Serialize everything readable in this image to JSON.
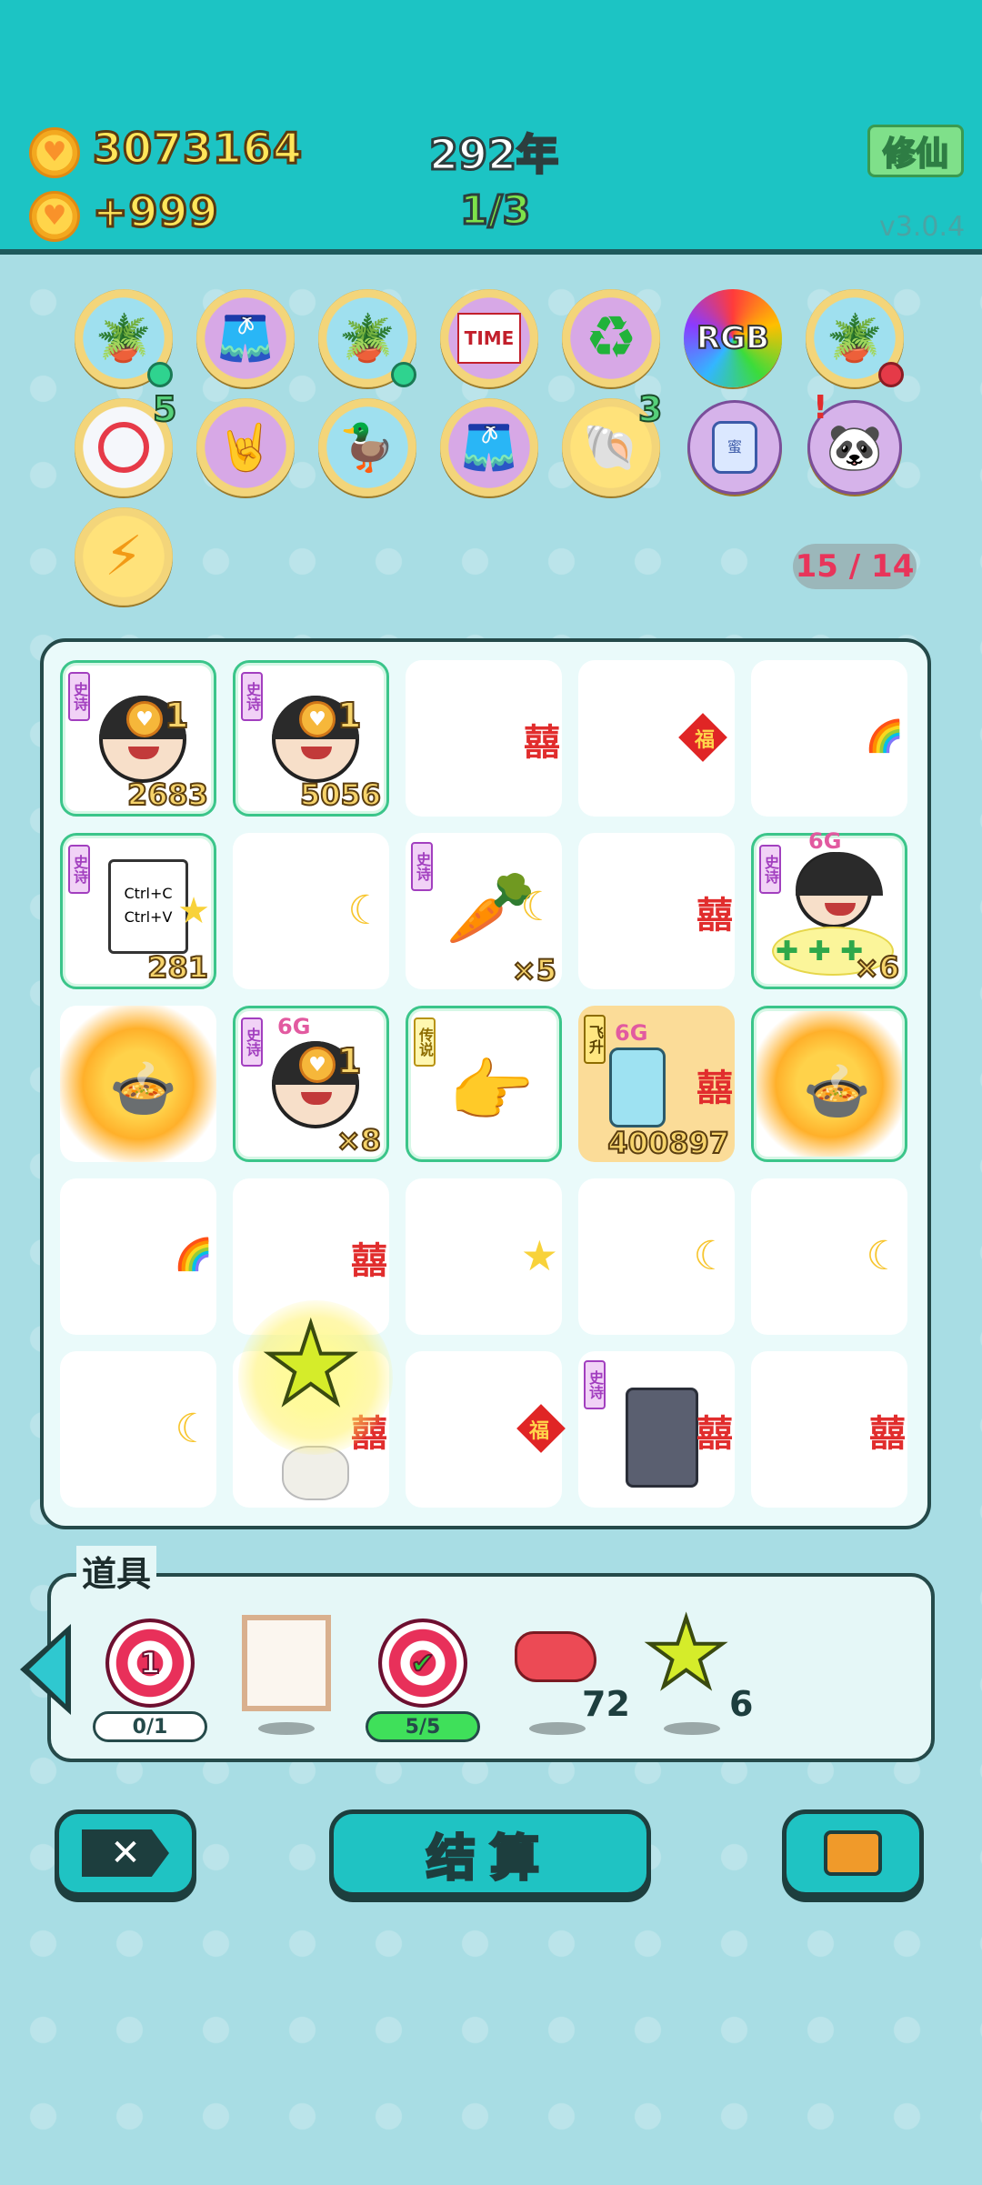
{
  "header": {
    "coins": "3073164",
    "income": "+999",
    "year": "292年",
    "round": "1/3",
    "mode_button": "修仙",
    "version": "v3.0.4"
  },
  "badges_row1": [
    "flower-pot-icon",
    "skirt-icon",
    "flower-pot-icon",
    "time-magazine-icon",
    "recycle-icon",
    "rgb-icon",
    "flower-pot-icon"
  ],
  "badges_row2": [
    "minus-icon",
    "rock-hand-icon",
    "duck-pot-icon",
    "skirt-icon",
    "shell-icon",
    "jar-icon",
    "panda-icon"
  ],
  "badge_counts": {
    "minus": "5",
    "shell": "3"
  },
  "badge_extra": {
    "rgb_text": "RGB",
    "time_text": "TIME",
    "jar_text": "蜜"
  },
  "energy_badge": "lightning-icon",
  "counter": "15 / 14",
  "grid": {
    "tags": {
      "epic": "史诗",
      "legend": "传说",
      "fly": "飞升"
    },
    "cells": {
      "r1c1_coin": "1",
      "r1c1_value": "2683",
      "r1c2_coin": "1",
      "r1c2_value": "5056",
      "r2c1_value": "281",
      "r2c1_text1": "Ctrl+C",
      "r2c1_text2": "Ctrl+V",
      "r2c3_value": "×5",
      "r2c5_value": "×6",
      "r2c5_crown": "6G",
      "r3c2_crown": "6G",
      "r3c2_coin": "1",
      "r3c2_value": "×8",
      "r3c4_crown": "6G",
      "r3c4_value": "400897"
    },
    "xi": "囍",
    "fu": "福"
  },
  "tools": {
    "title": "道具",
    "items": [
      {
        "icon": "target-icon",
        "num": "1",
        "label": "0/1"
      },
      {
        "icon": "frame-icon"
      },
      {
        "icon": "target-check-icon",
        "label": "5/5"
      },
      {
        "icon": "liver-icon",
        "count": "72"
      },
      {
        "icon": "star-icon",
        "count": "6"
      }
    ]
  },
  "actions": {
    "settle_label": "结算"
  },
  "colors": {
    "teal": "#1cc4c4",
    "dark": "#1d3e3e",
    "gold": "#ffe65a",
    "green": "#7de24a",
    "red_xi": "#e12d2d"
  }
}
